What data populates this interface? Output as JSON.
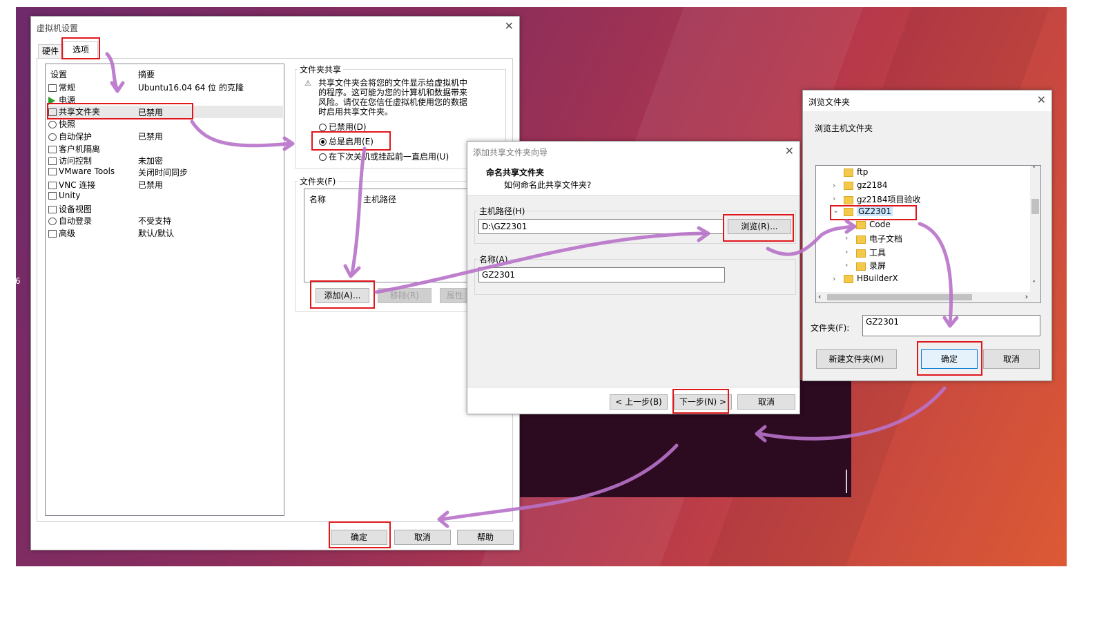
{
  "desktop": {
    "edge_text": "6"
  },
  "vm_settings": {
    "title": "虚拟机设置",
    "close": "✕",
    "tabs": [
      {
        "label": "硬件"
      },
      {
        "label": "选项"
      }
    ],
    "list_headers": {
      "setting": "设置",
      "summary": "摘要"
    },
    "items": [
      {
        "label": "常规",
        "summary": "Ubuntu16.04 64 位 的克隆"
      },
      {
        "label": "电源",
        "summary": ""
      },
      {
        "label": "共享文件夹",
        "summary": "已禁用"
      },
      {
        "label": "快照",
        "summary": ""
      },
      {
        "label": "自动保护",
        "summary": "已禁用"
      },
      {
        "label": "客户机隔离",
        "summary": ""
      },
      {
        "label": "访问控制",
        "summary": "未加密"
      },
      {
        "label": "VMware Tools",
        "summary": "关闭时间同步"
      },
      {
        "label": "VNC 连接",
        "summary": "已禁用"
      },
      {
        "label": "Unity",
        "summary": ""
      },
      {
        "label": "设备视图",
        "summary": ""
      },
      {
        "label": "自动登录",
        "summary": "不受支持"
      },
      {
        "label": "高级",
        "summary": "默认/默认"
      }
    ],
    "folder_sharing": {
      "group_label": "文件夹共享",
      "warning_lines": [
        "共享文件夹会将您的文件显示给虚拟机中",
        "的程序。这可能为您的计算机和数据带来",
        "风险。请仅在您信任虚拟机使用您的数据",
        "时启用共享文件夹。"
      ],
      "options": [
        "已禁用(D)",
        "总是启用(E)",
        "在下次关机或挂起前一直启用(U)"
      ],
      "selected": "总是启用(E)"
    },
    "folders": {
      "group_label": "文件夹(F)",
      "col_name": "名称",
      "col_path": "主机路径",
      "add_button": "添加(A)...",
      "remove_button": "移除(R)",
      "properties_button": "属性"
    },
    "buttons": {
      "ok": "确定",
      "cancel": "取消",
      "help": "帮助"
    }
  },
  "wizard": {
    "title": "添加共享文件夹向导",
    "close": "✕",
    "heading": "命名共享文件夹",
    "subheading": "如何命名此共享文件夹?",
    "host_path_label": "主机路径(H)",
    "host_path_value": "D:\\GZ2301",
    "browse_button": "浏览(R)...",
    "name_label": "名称(A)",
    "name_value": "GZ2301",
    "back_button": "< 上一步(B)",
    "next_button": "下一步(N) >",
    "cancel_button": "取消"
  },
  "browse": {
    "title": "浏览文件夹",
    "close": "✕",
    "prompt": "浏览主机文件夹",
    "tree": [
      {
        "label": "ftp",
        "expander": ""
      },
      {
        "label": "gz2184",
        "expander": "›"
      },
      {
        "label": "gz2184项目验收",
        "expander": "›"
      },
      {
        "label": "GZ2301",
        "expander": "⌄",
        "selected": true
      },
      {
        "label": "Code",
        "expander": ""
      },
      {
        "label": "电子文档",
        "expander": "›"
      },
      {
        "label": "工具",
        "expander": "›"
      },
      {
        "label": "录屏",
        "expander": "›"
      },
      {
        "label": "HBuilderX",
        "expander": "›"
      }
    ],
    "scroll_up": "˄",
    "scroll_down": "˅",
    "scroll_left": "‹",
    "scroll_right": "›",
    "folder_label": "文件夹(F):",
    "folder_value": "GZ2301",
    "new_folder_button": "新建文件夹(M)",
    "ok_button": "确定",
    "cancel_button": "取消"
  },
  "colors": {
    "highlight": "#e0161b",
    "arrow": "#b872c9",
    "accent": "#0078d7"
  }
}
